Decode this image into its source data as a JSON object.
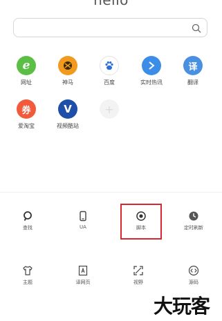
{
  "header": {
    "title": "hello"
  },
  "search": {
    "placeholder": "",
    "icon": "search-icon"
  },
  "shortcuts": [
    {
      "label": "网址",
      "glyph": "e",
      "color": "#5bbf45",
      "icon": "browser-e-icon"
    },
    {
      "label": "神马",
      "glyph": "◉",
      "color": "#f29a1d",
      "icon": "shenma-icon"
    },
    {
      "label": "百度",
      "glyph": "🐾",
      "color": "#ffffff",
      "icon": "baidu-paw-icon"
    },
    {
      "label": "实时热讯",
      "glyph": "⚡",
      "color": "#3b8de8",
      "icon": "hot-news-icon"
    },
    {
      "label": "翻译",
      "glyph": "译",
      "color": "#4a90e2",
      "icon": "translate-icon"
    },
    {
      "label": "爱淘宝",
      "glyph": "券",
      "color": "#f25a3c",
      "icon": "taobao-coupon-icon"
    },
    {
      "label": "视频酷站",
      "glyph": "V",
      "color": "#1d4ea8",
      "icon": "video-v-icon"
    },
    {
      "label": "",
      "glyph": "+",
      "color": "#f0f0f0",
      "icon": "add-shortcut-icon"
    }
  ],
  "tools_row1": [
    {
      "label": "查找",
      "icon": "search-icon"
    },
    {
      "label": "UA",
      "icon": "phone-ua-icon"
    },
    {
      "label": "脚本",
      "icon": "script-target-icon"
    },
    {
      "label": "定时刷新",
      "icon": "clock-icon"
    }
  ],
  "tools_row2": [
    {
      "label": "主题",
      "icon": "tshirt-theme-icon"
    },
    {
      "label": "译网页",
      "icon": "translate-page-icon"
    },
    {
      "label": "视野",
      "icon": "expand-view-icon"
    },
    {
      "label": "源码",
      "icon": "source-code-icon"
    }
  ],
  "watermark": {
    "text": "大玩客"
  },
  "colors": {
    "highlight": "#d8262e"
  }
}
